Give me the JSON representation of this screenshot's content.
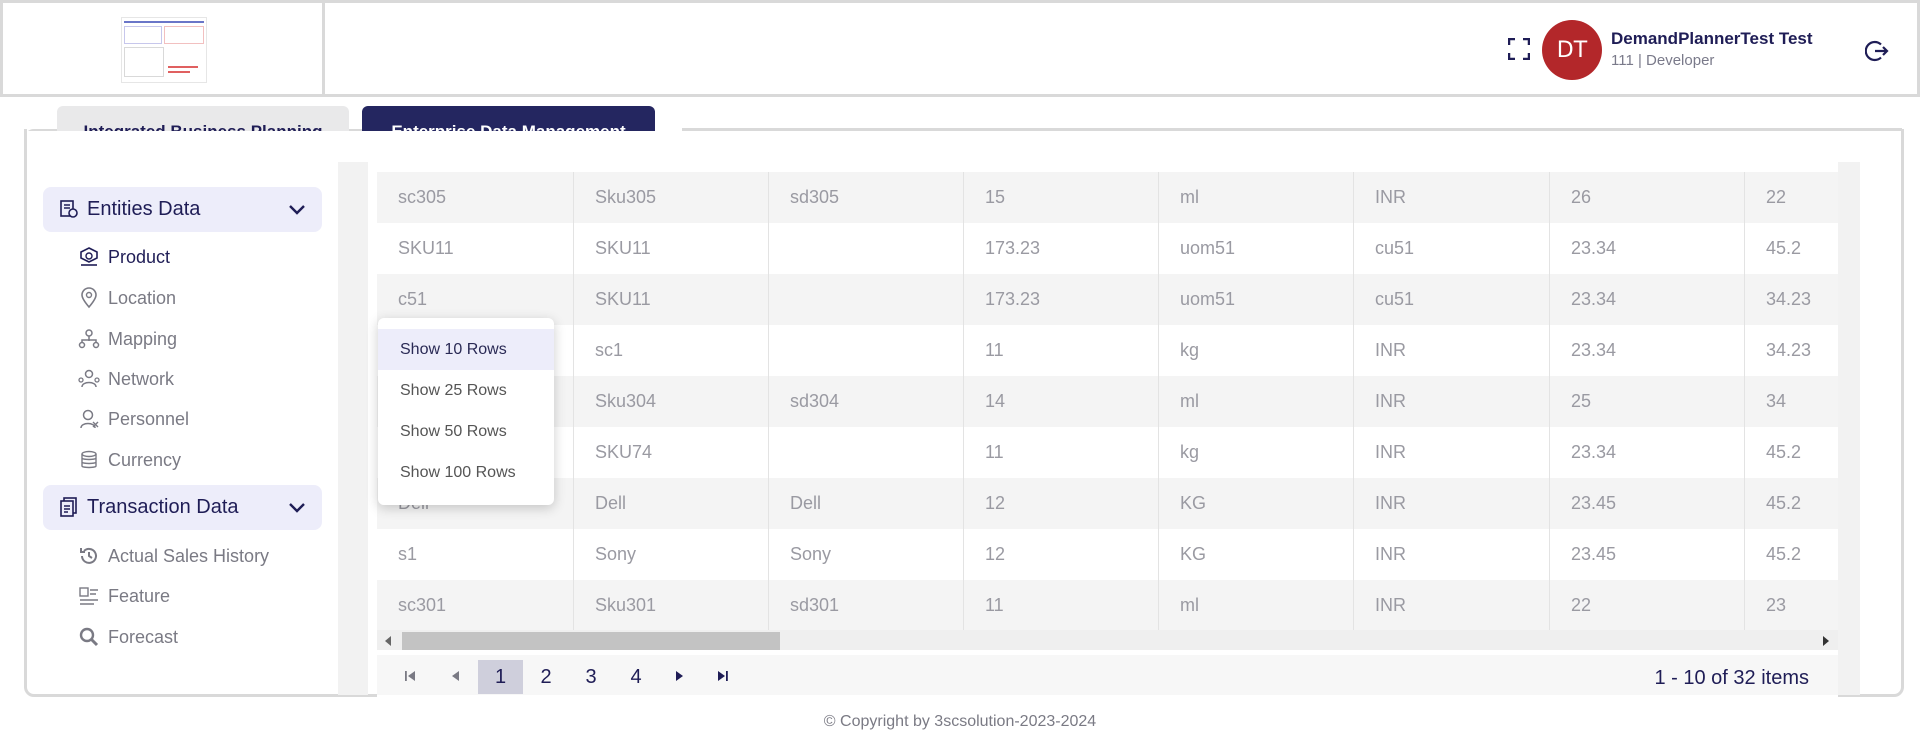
{
  "header": {
    "user_initials": "DT",
    "user_name": "DemandPlannerTest Test",
    "user_role": "111 | Developer"
  },
  "tabs": [
    {
      "label": "Integrated Business Planning",
      "active": false
    },
    {
      "label": "Enterprise Data Management",
      "active": true
    }
  ],
  "sidebar": {
    "entities": {
      "label": "Entities Data",
      "items": [
        {
          "label": "Product",
          "icon": "product-icon",
          "active": true
        },
        {
          "label": "Location",
          "icon": "location-pin-icon"
        },
        {
          "label": "Mapping",
          "icon": "mapping-icon"
        },
        {
          "label": "Network",
          "icon": "network-icon"
        },
        {
          "label": "Personnel",
          "icon": "personnel-icon"
        },
        {
          "label": "Currency",
          "icon": "currency-coins-icon"
        }
      ]
    },
    "transactions": {
      "label": "Transaction Data",
      "items": [
        {
          "label": "Actual Sales History",
          "icon": "history-icon"
        },
        {
          "label": "Feature",
          "icon": "feature-icon"
        },
        {
          "label": "Forecast",
          "icon": "search-icon"
        }
      ]
    }
  },
  "table": {
    "rows": [
      [
        "sc305",
        "Sku305",
        "sd305",
        "15",
        "ml",
        "INR",
        "26",
        "22"
      ],
      [
        "SKU11",
        "SKU11",
        "",
        "173.23",
        "uom51",
        "cu51",
        "23.34",
        "45.2"
      ],
      [
        "c51",
        "SKU11",
        "",
        "173.23",
        "uom51",
        "cu51",
        "23.34",
        "34.23"
      ],
      [
        "",
        "sc1",
        "",
        "11",
        "kg",
        "INR",
        "23.34",
        "34.23"
      ],
      [
        "",
        "Sku304",
        "sd304",
        "14",
        "ml",
        "INR",
        "25",
        "34"
      ],
      [
        "",
        "SKU74",
        "",
        "11",
        "kg",
        "INR",
        "23.34",
        "45.2"
      ],
      [
        "Dell",
        "Dell",
        "Dell",
        "12",
        "KG",
        "INR",
        "23.45",
        "45.2"
      ],
      [
        "s1",
        "Sony",
        "Sony",
        "12",
        "KG",
        "INR",
        "23.45",
        "45.2"
      ],
      [
        "sc301",
        "Sku301",
        "sd301",
        "11",
        "ml",
        "INR",
        "22",
        "23"
      ]
    ]
  },
  "pager": {
    "pages": [
      "1",
      "2",
      "3",
      "4"
    ],
    "current_page": "1",
    "info": "1 - 10 of 32 items"
  },
  "page_size_menu": {
    "options": [
      "Show 10 Rows",
      "Show 25 Rows",
      "Show 50 Rows",
      "Show 100 Rows"
    ],
    "selected": "Show 10 Rows"
  },
  "footer": {
    "copyright": "© Copyright by 3scsolution-2023-2024"
  },
  "colors": {
    "brand_navy": "#242660",
    "avatar_red": "#b3272a",
    "section_bg": "#ededfa"
  }
}
